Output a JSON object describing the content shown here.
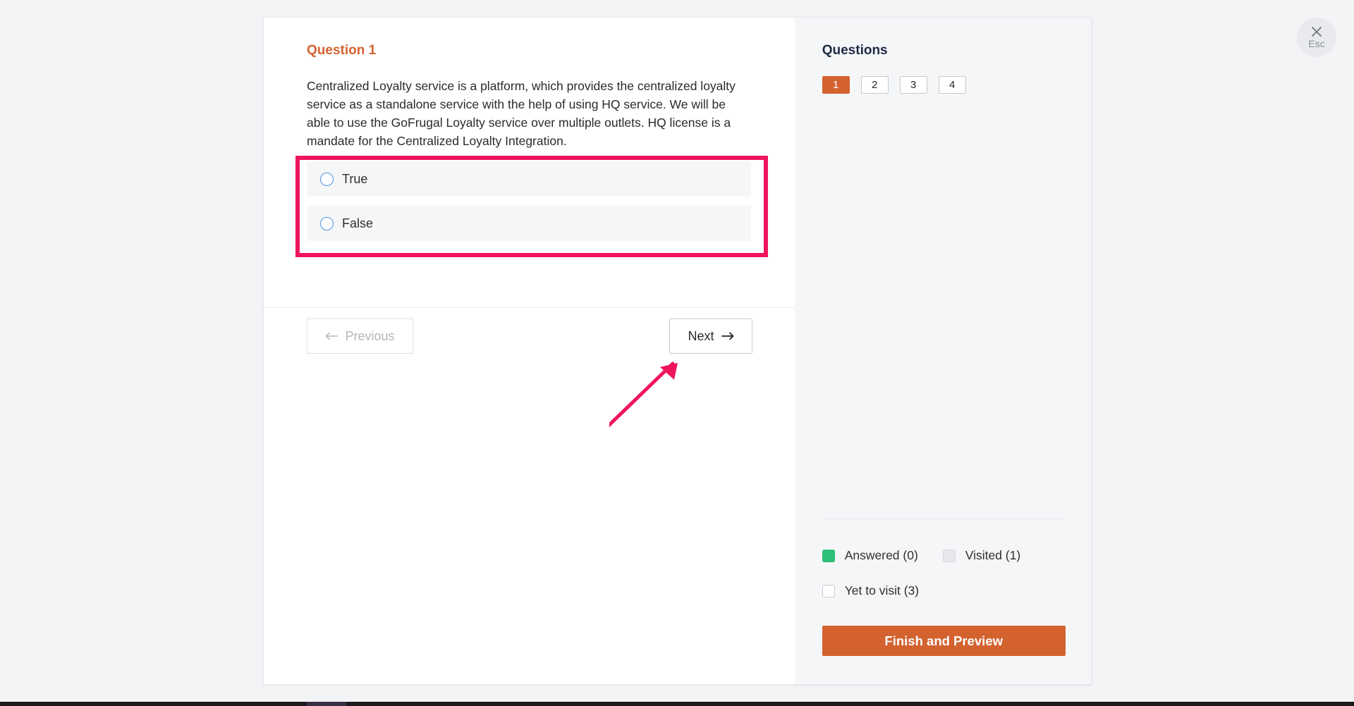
{
  "question": {
    "title": "Question 1",
    "text": "Centralized Loyalty service is a platform, which provides the centralized loyalty service as a standalone service with the help of using HQ service. We will be able to use the GoFrugal Loyalty service over multiple outlets. HQ license is a mandate for the Centralized Loyalty Integration.",
    "options": [
      {
        "label": "True"
      },
      {
        "label": "False"
      }
    ]
  },
  "navigation": {
    "previous_label": "Previous",
    "next_label": "Next"
  },
  "sidebar": {
    "title": "Questions",
    "question_numbers": [
      "1",
      "2",
      "3",
      "4"
    ],
    "active_question": "1",
    "legend": {
      "answered": "Answered (0)",
      "visited": "Visited (1)",
      "yet_to_visit": "Yet to visit (3)"
    },
    "finish_label": "Finish and Preview"
  },
  "close": {
    "label": "Esc"
  },
  "colors": {
    "accent": "#d3622f",
    "answered": "#2bbf77",
    "highlight": "#f0145b",
    "radio": "#4a90e2"
  },
  "icons": {
    "close": "close-icon",
    "previous": "arrow-left-icon",
    "next": "arrow-right-icon",
    "pointer": "annotation-arrow-icon"
  }
}
